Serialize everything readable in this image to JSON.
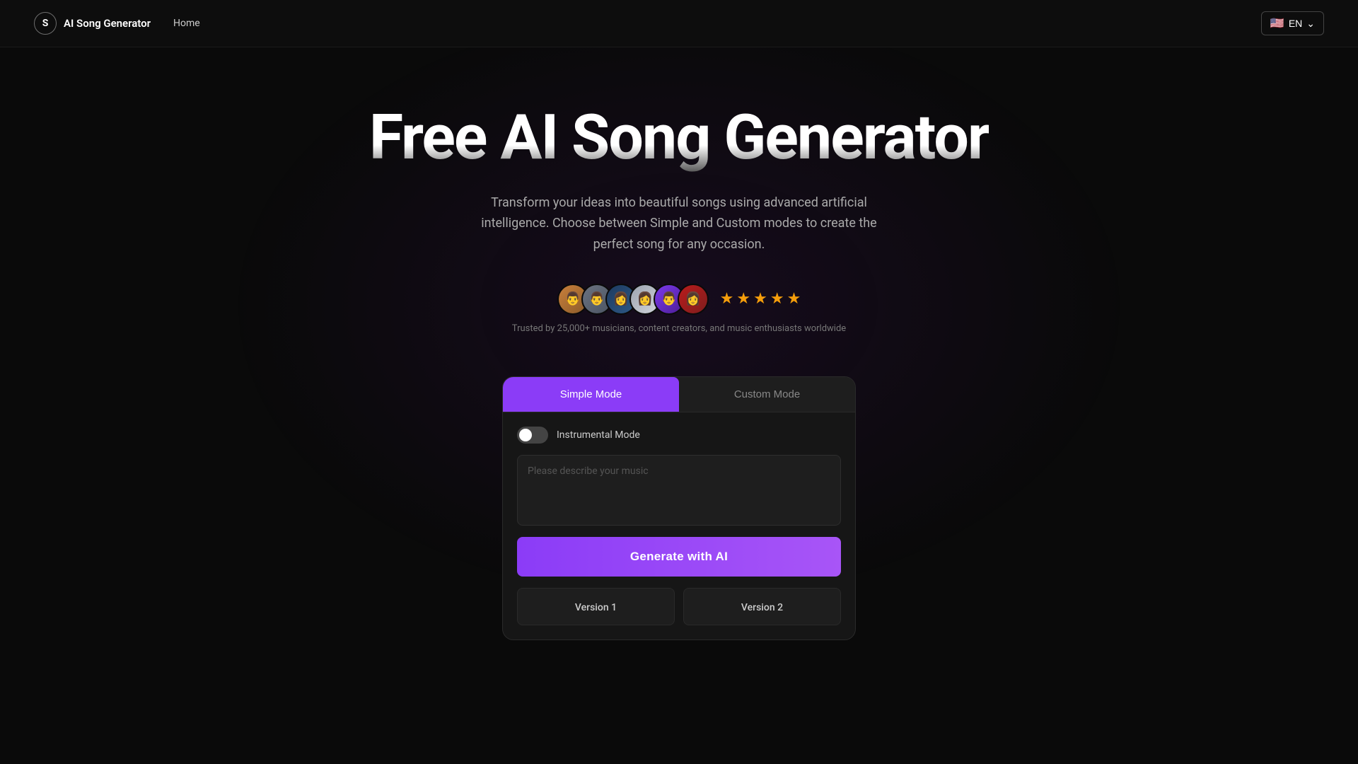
{
  "navbar": {
    "logo_icon": "S",
    "logo_text": "AI Song Generator",
    "nav_home": "Home",
    "lang_code": "EN",
    "lang_flag": "🇺🇸",
    "lang_arrow": "⌄"
  },
  "hero": {
    "title": "Free AI Song Generator",
    "subtitle": "Transform your ideas into beautiful songs using advanced artificial intelligence. Choose between Simple and Custom modes to create the perfect song for any occasion.",
    "trusted_text": "Trusted by 25,000+ musicians, content creators, and music enthusiasts worldwide",
    "stars": [
      "★",
      "★",
      "★",
      "★",
      "★"
    ]
  },
  "avatars": [
    {
      "id": 1,
      "emoji": "👨"
    },
    {
      "id": 2,
      "emoji": "👨"
    },
    {
      "id": 3,
      "emoji": "👩"
    },
    {
      "id": 4,
      "emoji": "👩"
    },
    {
      "id": 5,
      "emoji": "👨"
    },
    {
      "id": 6,
      "emoji": "👩"
    }
  ],
  "card": {
    "tab_simple": "Simple Mode",
    "tab_custom": "Custom Mode",
    "toggle_label": "Instrumental Mode",
    "textarea_placeholder": "Please describe your music",
    "generate_btn": "Generate with AI",
    "version1_label": "Version 1",
    "version2_label": "Version 2"
  }
}
